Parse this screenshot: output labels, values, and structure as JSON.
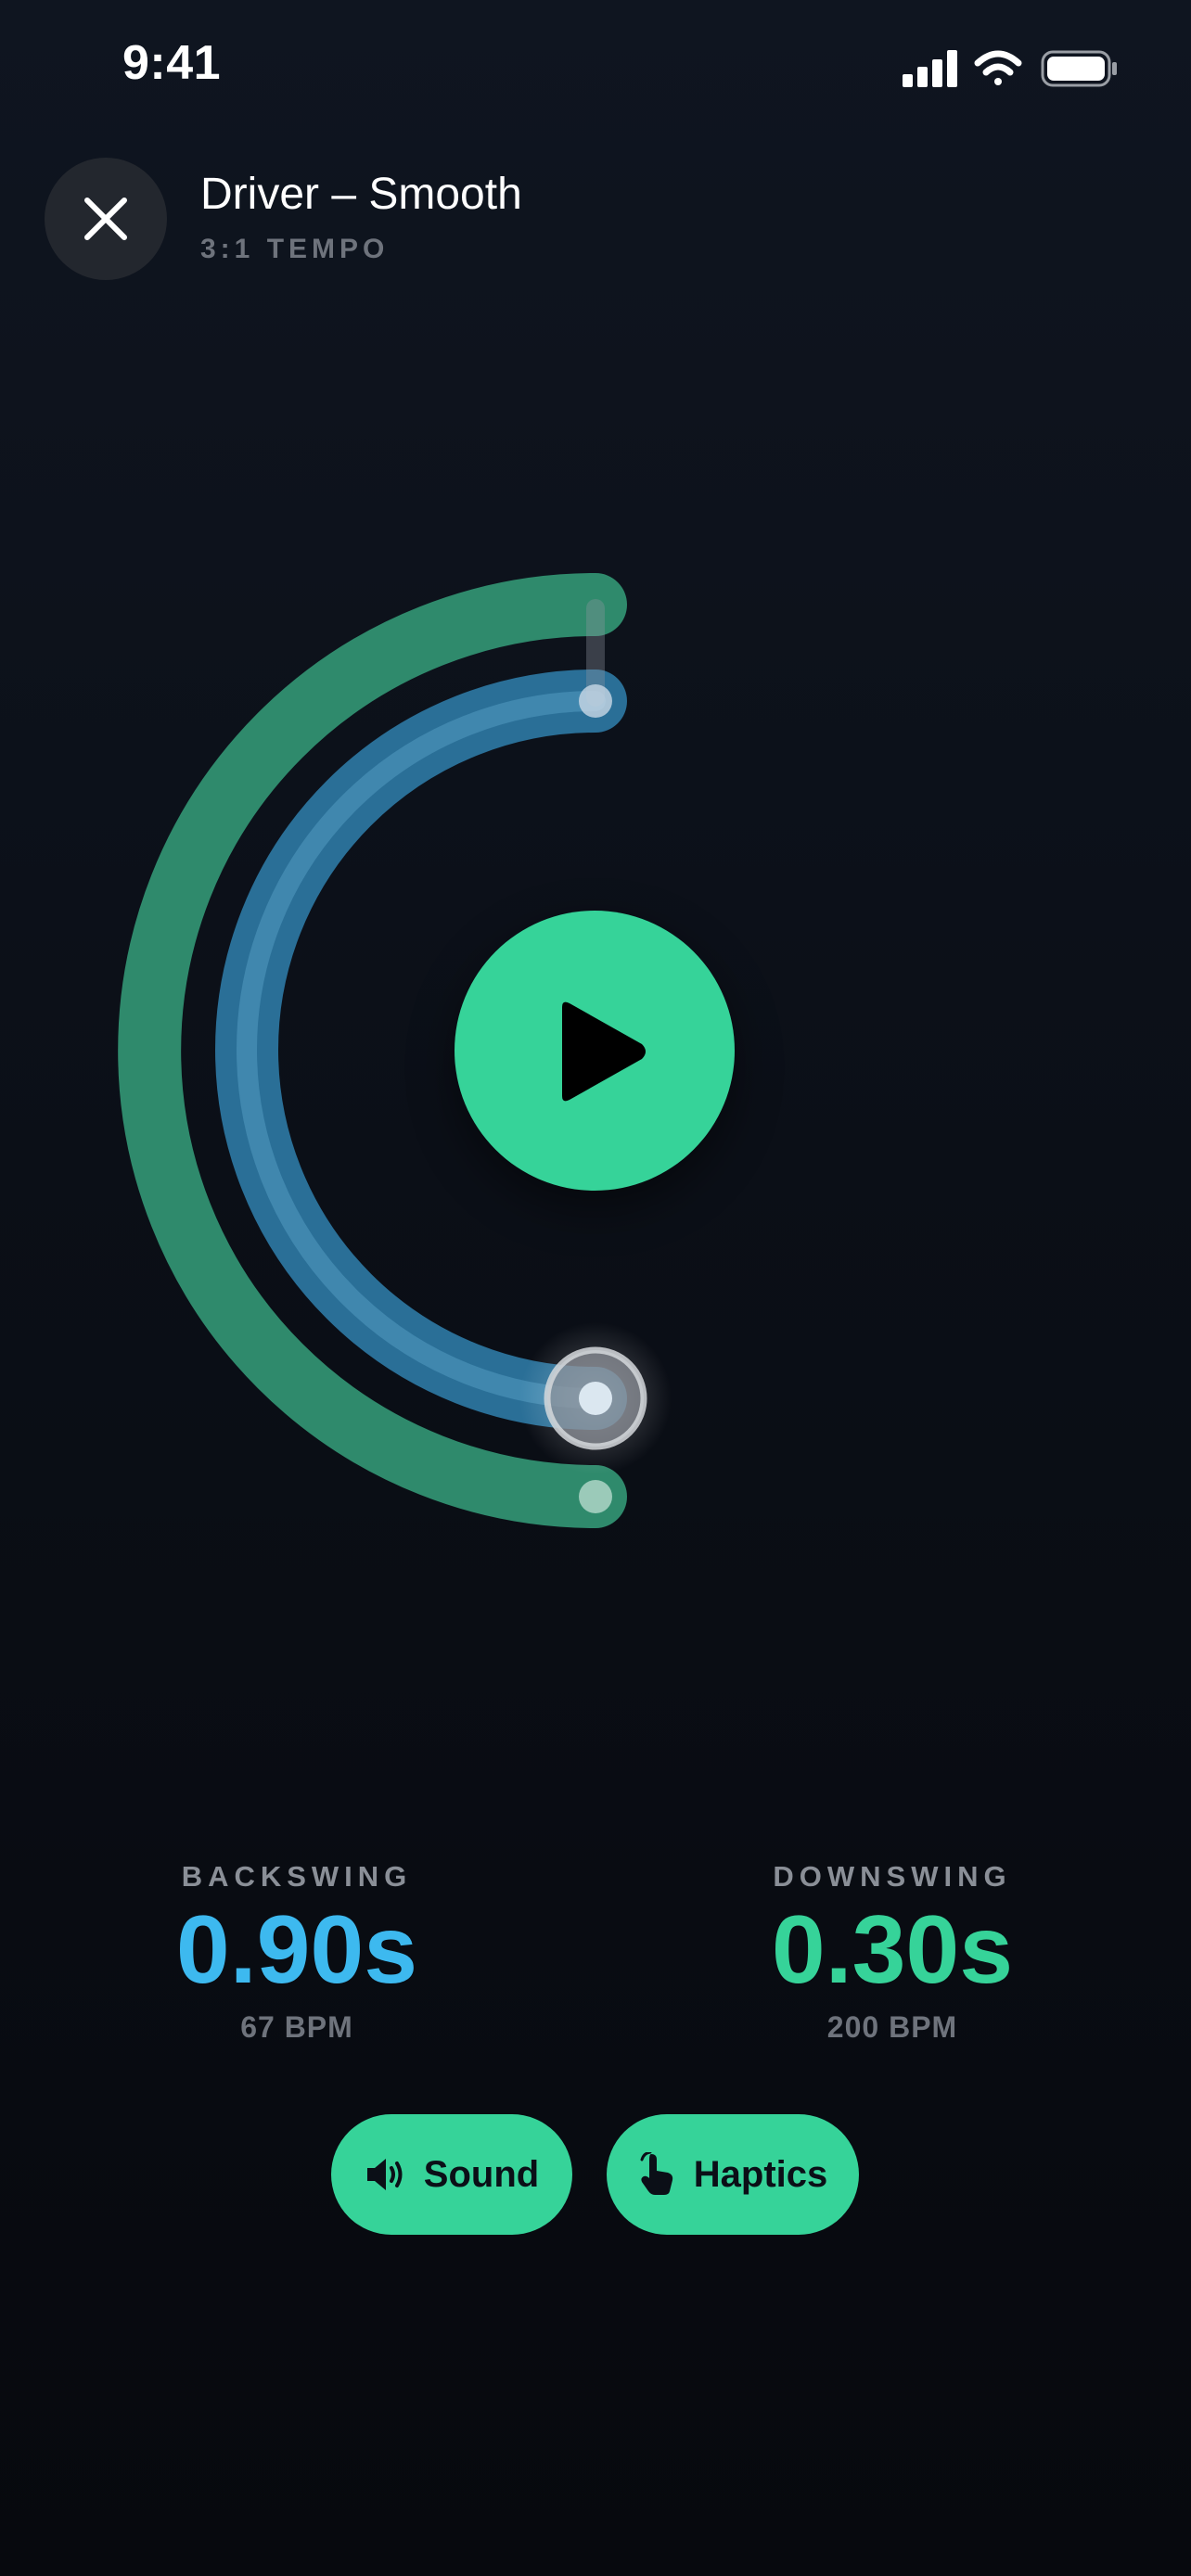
{
  "status_bar": {
    "time": "9:41",
    "icons": [
      "cellular-signal-icon",
      "wifi-icon",
      "battery-icon"
    ]
  },
  "header": {
    "close_icon": "close-icon",
    "title": "Driver – Smooth",
    "subtitle": "3:1 TEMPO"
  },
  "tempo_visual": {
    "play_icon": "play-icon",
    "colors": {
      "backswing": "#2f8a6c",
      "downswing": "#2a6f97",
      "accent": "#36d399",
      "backswing_text": "#3db9ef"
    }
  },
  "backswing": {
    "label": "BACKSWING",
    "value": "0.90s",
    "bpm": "67 BPM"
  },
  "downswing": {
    "label": "DOWNSWING",
    "value": "0.30s",
    "bpm": "200 BPM"
  },
  "toggles": {
    "sound": {
      "label": "Sound",
      "icon": "speaker-icon"
    },
    "haptics": {
      "label": "Haptics",
      "icon": "hand-tap-icon"
    }
  }
}
